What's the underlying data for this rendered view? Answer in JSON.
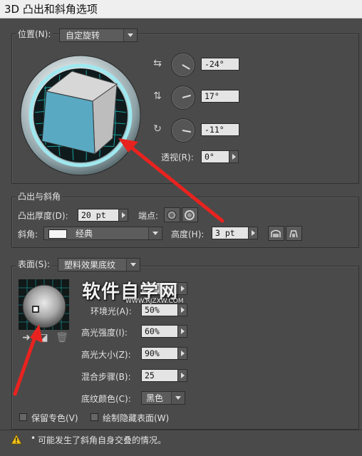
{
  "window": {
    "title": "3D 凸出和斜角选项"
  },
  "position": {
    "label": "位置(N):",
    "preset": "自定旋转",
    "rotation_x": "-24°",
    "rotation_y": "17°",
    "rotation_z": "-11°",
    "perspective_label": "透视(R):",
    "perspective": "0°"
  },
  "extrude": {
    "section_label": "凸出与斜角",
    "depth_label": "凸出厚度(D):",
    "depth": "20 pt",
    "cap_label": "端点:",
    "bevel_label": "斜角:",
    "bevel": "经典",
    "height_label": "高度(H):",
    "height": "3 pt"
  },
  "surface": {
    "label": "表面(S):",
    "type": "塑料效果底纹",
    "ambient_label": "环境光(A):",
    "ambient": "50%",
    "highlight_intensity_label": "高光强度(I):",
    "highlight_intensity": "60%",
    "highlight_size_label": "高光大小(Z):",
    "highlight_size": "90%",
    "blend_steps_label": "混合步骤(B):",
    "blend_steps": "25",
    "shading_color_label": "底纹颜色(C):",
    "shading_color": "黑色"
  },
  "options": {
    "preserve_spot_label": "保留专色(V)",
    "draw_hidden_label": "绘制隐藏表面(W)"
  },
  "warning": {
    "text": "可能发生了斜角自身交叠的情况。"
  },
  "watermark": {
    "title": "软件自学网",
    "url": "WWW.RJZXW.COM"
  },
  "colors": {
    "annotation_arrow": "#e8231f",
    "cube_front": "#5aa9c2",
    "teal_grid": "#1ecfcf"
  }
}
